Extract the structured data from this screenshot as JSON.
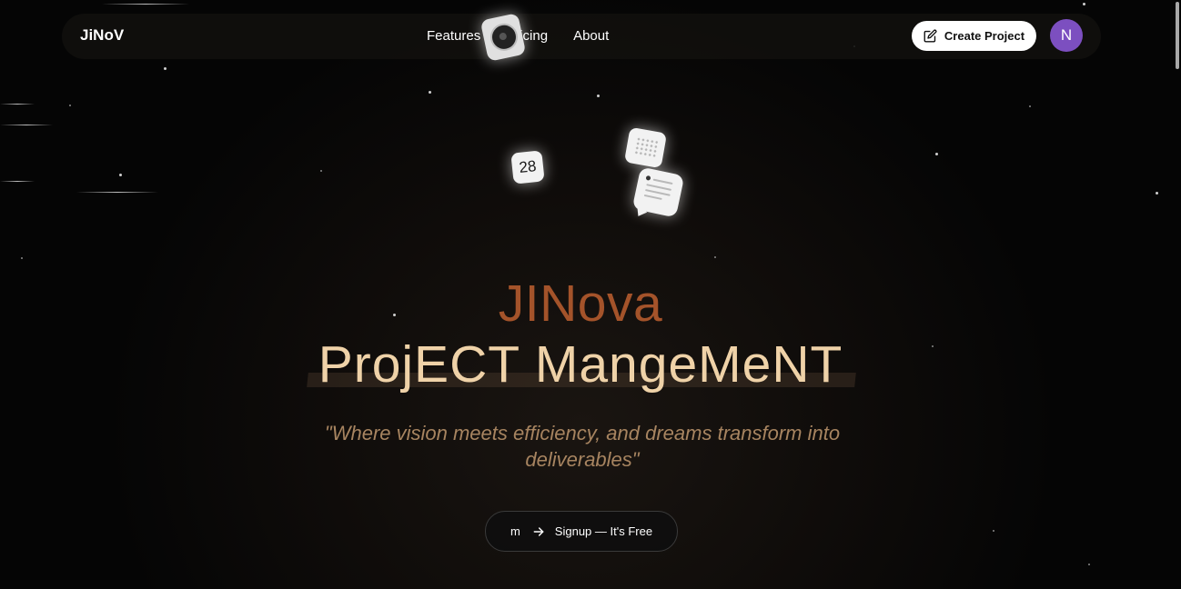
{
  "nav": {
    "brand": "JiNoV",
    "links": [
      "Features",
      "Pricing",
      "About"
    ],
    "create_button": "Create Project",
    "avatar_initial": "N"
  },
  "floating_icons": {
    "calendar_day": "28"
  },
  "hero": {
    "title_line1": "JINova",
    "title_line2": "ProjECT MangeMeNT",
    "quote": "\"Where vision meets efficiency, and dreams transform into deliverables\"",
    "signup_prefix": "m",
    "signup_label": "Signup — It's Free"
  },
  "colors": {
    "background": "#050505",
    "title_line1": "#a4532a",
    "title_line2": "#efd2a8",
    "quote": "#a78460",
    "avatar": "#7c4fc0"
  }
}
